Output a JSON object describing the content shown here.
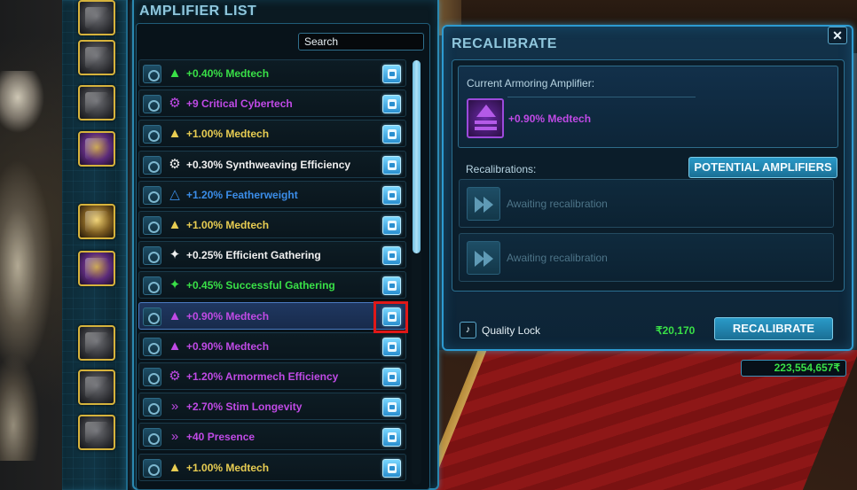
{
  "amplifier_list": {
    "title": "AMPLIFIER LIST",
    "search_label": "Search",
    "rows": [
      {
        "symbol": "▲",
        "label": "+0.40% Medtech",
        "color": "green",
        "color_hex": "#39e047",
        "selected": false
      },
      {
        "symbol": "⚙",
        "label": "+9 Critical Cybertech",
        "color": "purple",
        "color_hex": "#c04ae6",
        "selected": false
      },
      {
        "symbol": "▲",
        "label": "+1.00% Medtech",
        "color": "gold",
        "color_hex": "#e8cd52",
        "selected": false
      },
      {
        "symbol": "⚙",
        "label": "+0.30% Synthweaving Efficiency",
        "color": "white",
        "color_hex": "#f0f0f0",
        "selected": false
      },
      {
        "symbol": "△",
        "label": "+1.20% Featherweight",
        "color": "blue",
        "color_hex": "#3b8de8",
        "selected": false
      },
      {
        "symbol": "▲",
        "label": "+1.00% Medtech",
        "color": "gold",
        "color_hex": "#e8cd52",
        "selected": false
      },
      {
        "symbol": "✦",
        "label": "+0.25% Efficient Gathering",
        "color": "white",
        "color_hex": "#f0f0f0",
        "selected": false
      },
      {
        "symbol": "✦",
        "label": "+0.45% Successful Gathering",
        "color": "green",
        "color_hex": "#39e047",
        "selected": false
      },
      {
        "symbol": "▲",
        "label": "+0.90% Medtech",
        "color": "purple",
        "color_hex": "#c04ae6",
        "selected": true
      },
      {
        "symbol": "▲",
        "label": "+0.90% Medtech",
        "color": "purple",
        "color_hex": "#c04ae6",
        "selected": false
      },
      {
        "symbol": "⚙",
        "label": "+1.20% Armormech Efficiency",
        "color": "purple",
        "color_hex": "#c04ae6",
        "selected": false
      },
      {
        "symbol": "»",
        "label": "+2.70% Stim Longevity",
        "color": "purple",
        "color_hex": "#c04ae6",
        "selected": false
      },
      {
        "symbol": "»",
        "label": "+40 Presence",
        "color": "purple",
        "color_hex": "#c04ae6",
        "selected": false
      },
      {
        "symbol": "▲",
        "label": "+1.00% Medtech",
        "color": "gold",
        "color_hex": "#e8cd52",
        "selected": false
      }
    ],
    "row_icon": "item-slot-icon",
    "action_icon": "recalibrate-action-icon"
  },
  "recalibrate": {
    "title": "RECALIBRATE",
    "close_label": "✕",
    "current_label": "Current Armoring Amplifier:",
    "current_value": "+0.90% Medtech",
    "current_icon": "medtech-amplifier-icon",
    "recalibrations_label": "Recalibrations:",
    "potential_button": "POTENTIAL AMPLIFIERS",
    "slots": [
      {
        "text": "Awaiting recalibration",
        "icon": "chevrons-icon"
      },
      {
        "text": "Awaiting recalibration",
        "icon": "chevrons-icon"
      }
    ],
    "quality_lock_label": "Quality Lock",
    "cost": "₹20,170",
    "recalibrate_button": "RECALIBRATE"
  },
  "credits": "223,554,657₹",
  "equipment_slots": [
    {
      "icon": "helmet-icon"
    },
    {
      "icon": "chest-armor-icon"
    },
    {
      "icon": "datapad-icon"
    },
    {
      "icon": "gauntlet-icon"
    },
    {
      "icon": "blaster-icon"
    },
    {
      "icon": "blaster-offhand-icon"
    },
    {
      "icon": "belt-icon"
    },
    {
      "icon": "legs-icon"
    },
    {
      "icon": "boots-icon"
    }
  ],
  "colors": {
    "accent": "#2d9ad0",
    "green_credits": "#39e047",
    "highlight": "#e01818"
  }
}
